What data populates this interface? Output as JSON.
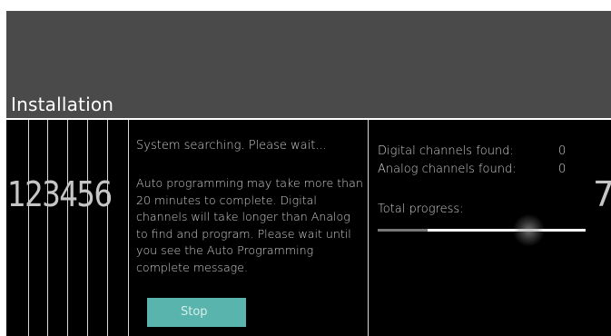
{
  "screen": {
    "title": "Installation"
  },
  "steps": {
    "left_numbers": "123456",
    "right_number": "7"
  },
  "status": {
    "searching_text": "System searching. Please wait...",
    "notice_text": "Auto programming may take more than 20 minutes to complete. Digital channels will take longer than Analog to find and program. Please wait until you see the Auto Programming complete message."
  },
  "actions": {
    "stop_label": "Stop"
  },
  "results": {
    "digital_label": "Digital channels found:",
    "digital_value": "0",
    "analog_label": "Analog channels found:",
    "analog_value": "0"
  },
  "progress": {
    "label": "Total progress:",
    "value": 0.24
  },
  "colors": {
    "header_background": "#4a4a4a",
    "body_background": "#000000",
    "button_background": "#58b4ad",
    "text": "#cfcfcf",
    "progress_track": "#ffffff",
    "progress_fill": "#777777"
  }
}
